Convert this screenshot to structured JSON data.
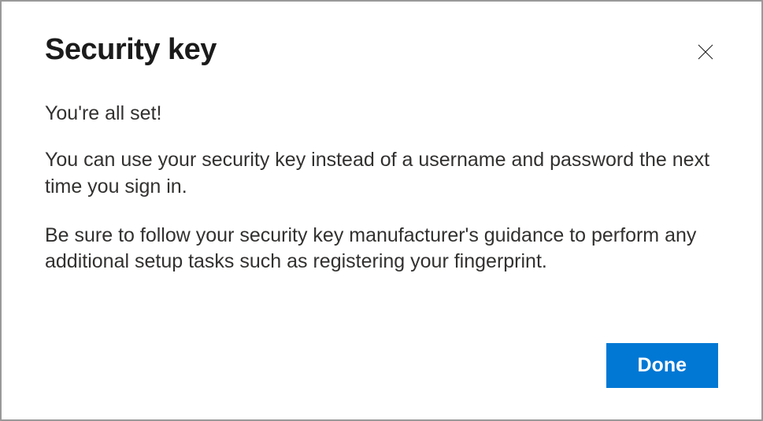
{
  "dialog": {
    "title": "Security key",
    "message1": "You're all set!",
    "message2": "You can use your security key instead of a username and password the next time you sign in.",
    "message3": "Be sure to follow your security key manufacturer's guidance to perform any additional setup tasks such as registering your fingerprint.",
    "done_label": "Done"
  }
}
